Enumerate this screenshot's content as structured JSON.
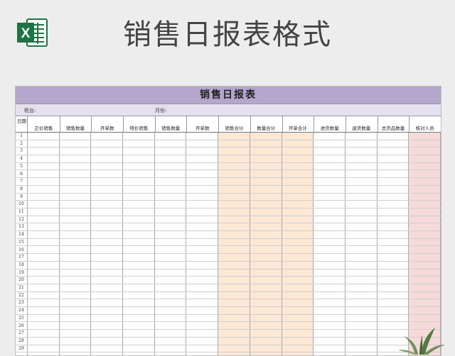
{
  "page": {
    "title": "销售日报表格式",
    "icon_letter": "X"
  },
  "sheet": {
    "title": "销售日报表",
    "counter_label": "柜台:",
    "month_label": "月份:",
    "date_header": "日期",
    "columns": [
      "正价销售",
      "销售数量",
      "开单数",
      "特价销售",
      "销售数量",
      "开单数",
      "销售合计",
      "数量合计",
      "开单合计",
      "进货数量",
      "退货数量",
      "总货品数量",
      "核对人员"
    ],
    "row_numbers": [
      "1",
      "2",
      "3",
      "4",
      "5",
      "6",
      "7",
      "8",
      "9",
      "10",
      "11",
      "12",
      "13",
      "14",
      "15",
      "16",
      "17",
      "18",
      "19",
      "20",
      "21",
      "22",
      "23",
      "24",
      "25",
      "26",
      "27",
      "28",
      "29"
    ]
  },
  "colors": {
    "title_bar": "#b4a6cc",
    "info_bar": "#e4e0ef",
    "orange_cols": "#fde8d6",
    "pink_col": "#f6dada",
    "excel_green": "#1f7244"
  }
}
